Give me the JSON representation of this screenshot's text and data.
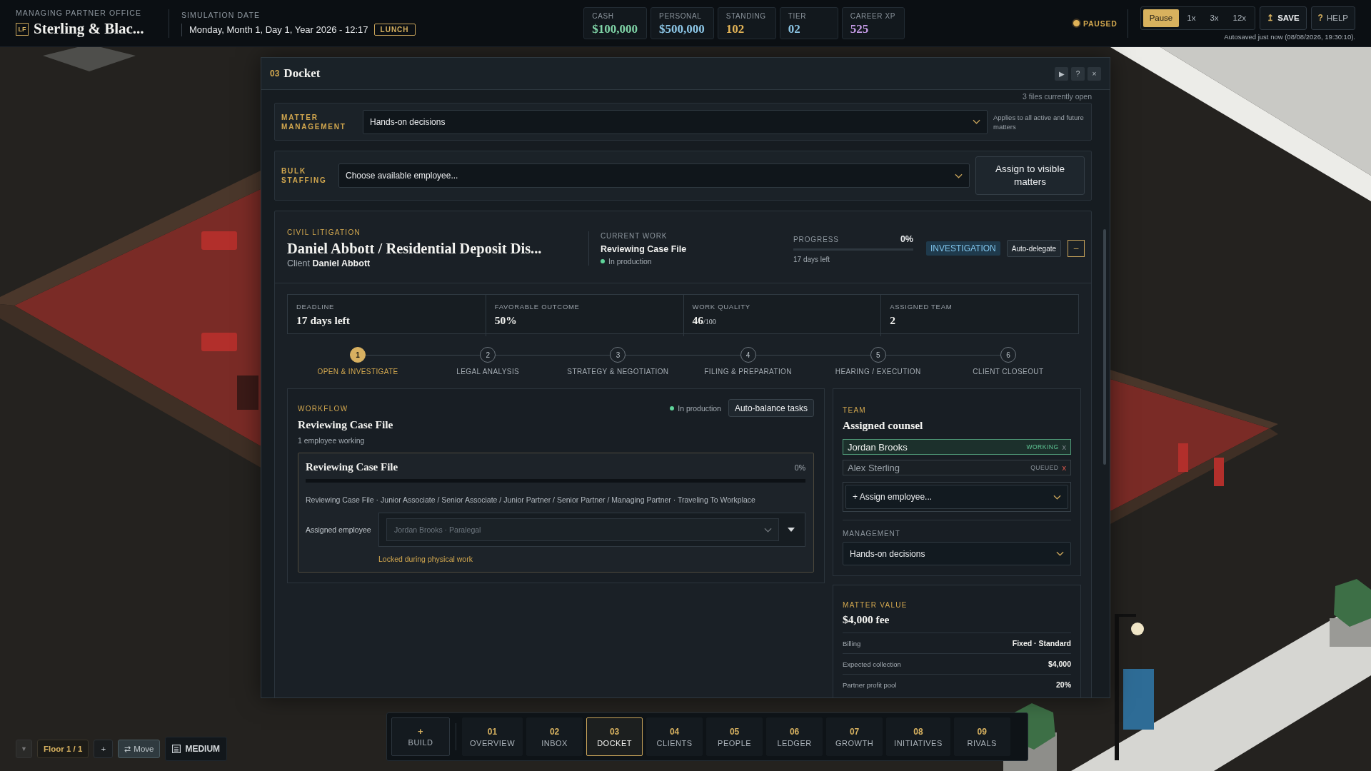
{
  "top_bar": {
    "office": {
      "caption": "MANAGING PARTNER OFFICE",
      "logo": "LF",
      "name": "Sterling & Blac..."
    },
    "date": {
      "caption": "SIMULATION DATE",
      "value": "Monday, Month 1, Day 1, Year 2026 - 12:17",
      "badge": "LUNCH"
    },
    "stats": [
      {
        "label": "CASH",
        "value": "$100,000",
        "color": "#7fd3a6"
      },
      {
        "label": "PERSONAL",
        "value": "$500,000",
        "color": "#8cc6e6"
      },
      {
        "label": "STANDING",
        "value": "102",
        "color": "#e3b457"
      },
      {
        "label": "TIER",
        "value": "02",
        "color": "#8cc6e6"
      },
      {
        "label": "CAREER XP",
        "value": "525",
        "color": "#c59be6"
      }
    ],
    "status": "PAUSED",
    "speed": [
      {
        "label": "Pause",
        "selected": true
      },
      {
        "label": "1x",
        "selected": false
      },
      {
        "label": "3x",
        "selected": false
      },
      {
        "label": "12x",
        "selected": false
      }
    ],
    "actions": [
      {
        "kind": "save",
        "icon": "↥",
        "label": "SAVE"
      },
      {
        "kind": "help",
        "icon": "?",
        "label": "HELP"
      }
    ],
    "autosave": "Autosaved just now (08/08/2026, 19:30:10)."
  },
  "docket": {
    "number": "03",
    "title": "Docket",
    "controls": [
      "▶",
      "?",
      "×"
    ],
    "files_open": "3 files currently open",
    "matter_management": {
      "label": "MATTER MANAGEMENT",
      "value": "Hands-on decisions",
      "note": "Applies to all active and future matters"
    },
    "bulk_staffing": {
      "label": "BULK STAFFING",
      "value": "Choose available employee...",
      "button": "Assign to visible matters"
    },
    "matter": {
      "category": "CIVIL LITIGATION",
      "title": "Daniel Abbott / Residential Deposit Dis...",
      "client_label": "Client",
      "client": "Daniel Abbott",
      "current_work": {
        "label": "CURRENT WORK",
        "value": "Reviewing Case File",
        "status": "In production"
      },
      "progress": {
        "label": "PROGRESS",
        "reading": "0%",
        "level": 0,
        "note": "17 days left"
      },
      "phase": "INVESTIGATION",
      "auto_delegate": "Auto-delegate",
      "collapse": "–",
      "stats": [
        {
          "label": "DEADLINE",
          "value": "17 days left"
        },
        {
          "label": "FAVORABLE OUTCOME",
          "value": "50%"
        },
        {
          "label": "WORK QUALITY",
          "value": "46",
          "suffix": "/100"
        },
        {
          "label": "ASSIGNED TEAM",
          "value": "2"
        }
      ],
      "steps": [
        {
          "number": "1",
          "label": "OPEN & INVESTIGATE",
          "selected": true
        },
        {
          "number": "2",
          "label": "LEGAL ANALYSIS",
          "selected": false
        },
        {
          "number": "3",
          "label": "STRATEGY & NEGOTIATION",
          "selected": false
        },
        {
          "number": "4",
          "label": "FILING & PREPARATION",
          "selected": false
        },
        {
          "number": "5",
          "label": "HEARING / EXECUTION",
          "selected": false
        },
        {
          "number": "6",
          "label": "CLIENT CLOSEOUT",
          "selected": false
        }
      ],
      "workflow": {
        "label": "WORKFLOW",
        "title": "Reviewing Case File",
        "status": "In production",
        "button": "Auto-balance tasks",
        "subtitle": "1 employee working",
        "task": {
          "title": "Reviewing Case File",
          "reading": "0%",
          "level": 0,
          "description": "Reviewing Case File · Junior Associate / Senior Associate / Junior Partner / Senior Partner / Managing Partner · Traveling To Workplace",
          "assignee": {
            "label": "Assigned employee",
            "value": "Jordan Brooks · Paralegal",
            "disabled": true
          },
          "lock_note": "Locked during physical work"
        }
      },
      "team": {
        "label": "TEAM",
        "title": "Assigned counsel",
        "members": [
          {
            "name": "Jordan Brooks",
            "status": "WORKING",
            "kind": "working",
            "remove": "x"
          },
          {
            "name": "Alex Sterling",
            "status": "QUEUED",
            "kind": "queued",
            "remove": "x"
          }
        ],
        "assign": "+ Assign employee...",
        "management_label": "MANAGEMENT",
        "management": "Hands-on decisions"
      },
      "value": {
        "label": "MATTER VALUE",
        "amount": "$4,000 fee",
        "rows": [
          {
            "label": "Billing",
            "value": "Fixed · Standard"
          },
          {
            "label": "Expected collection",
            "value": "$4,000"
          },
          {
            "label": "Partner profit pool",
            "value": "20%"
          }
        ]
      }
    }
  },
  "floor_controls": {
    "collapse": "▼",
    "floor": "Floor 1 / 1",
    "add": "+",
    "move": {
      "icon": "⇄",
      "label": "Move"
    },
    "view": "MEDIUM"
  },
  "nav": {
    "build": {
      "icon": "+",
      "label": "BUILD"
    },
    "tabs": [
      {
        "number": "01",
        "label": "OVERVIEW",
        "selected": false
      },
      {
        "number": "02",
        "label": "INBOX",
        "selected": false
      },
      {
        "number": "03",
        "label": "DOCKET",
        "selected": true
      },
      {
        "number": "04",
        "label": "CLIENTS",
        "selected": false
      },
      {
        "number": "05",
        "label": "PEOPLE",
        "selected": false
      },
      {
        "number": "06",
        "label": "LEDGER",
        "selected": false
      },
      {
        "number": "07",
        "label": "GROWTH",
        "selected": false
      },
      {
        "number": "08",
        "label": "INITIATIVES",
        "selected": false
      },
      {
        "number": "09",
        "label": "RIVALS",
        "selected": false
      }
    ]
  }
}
